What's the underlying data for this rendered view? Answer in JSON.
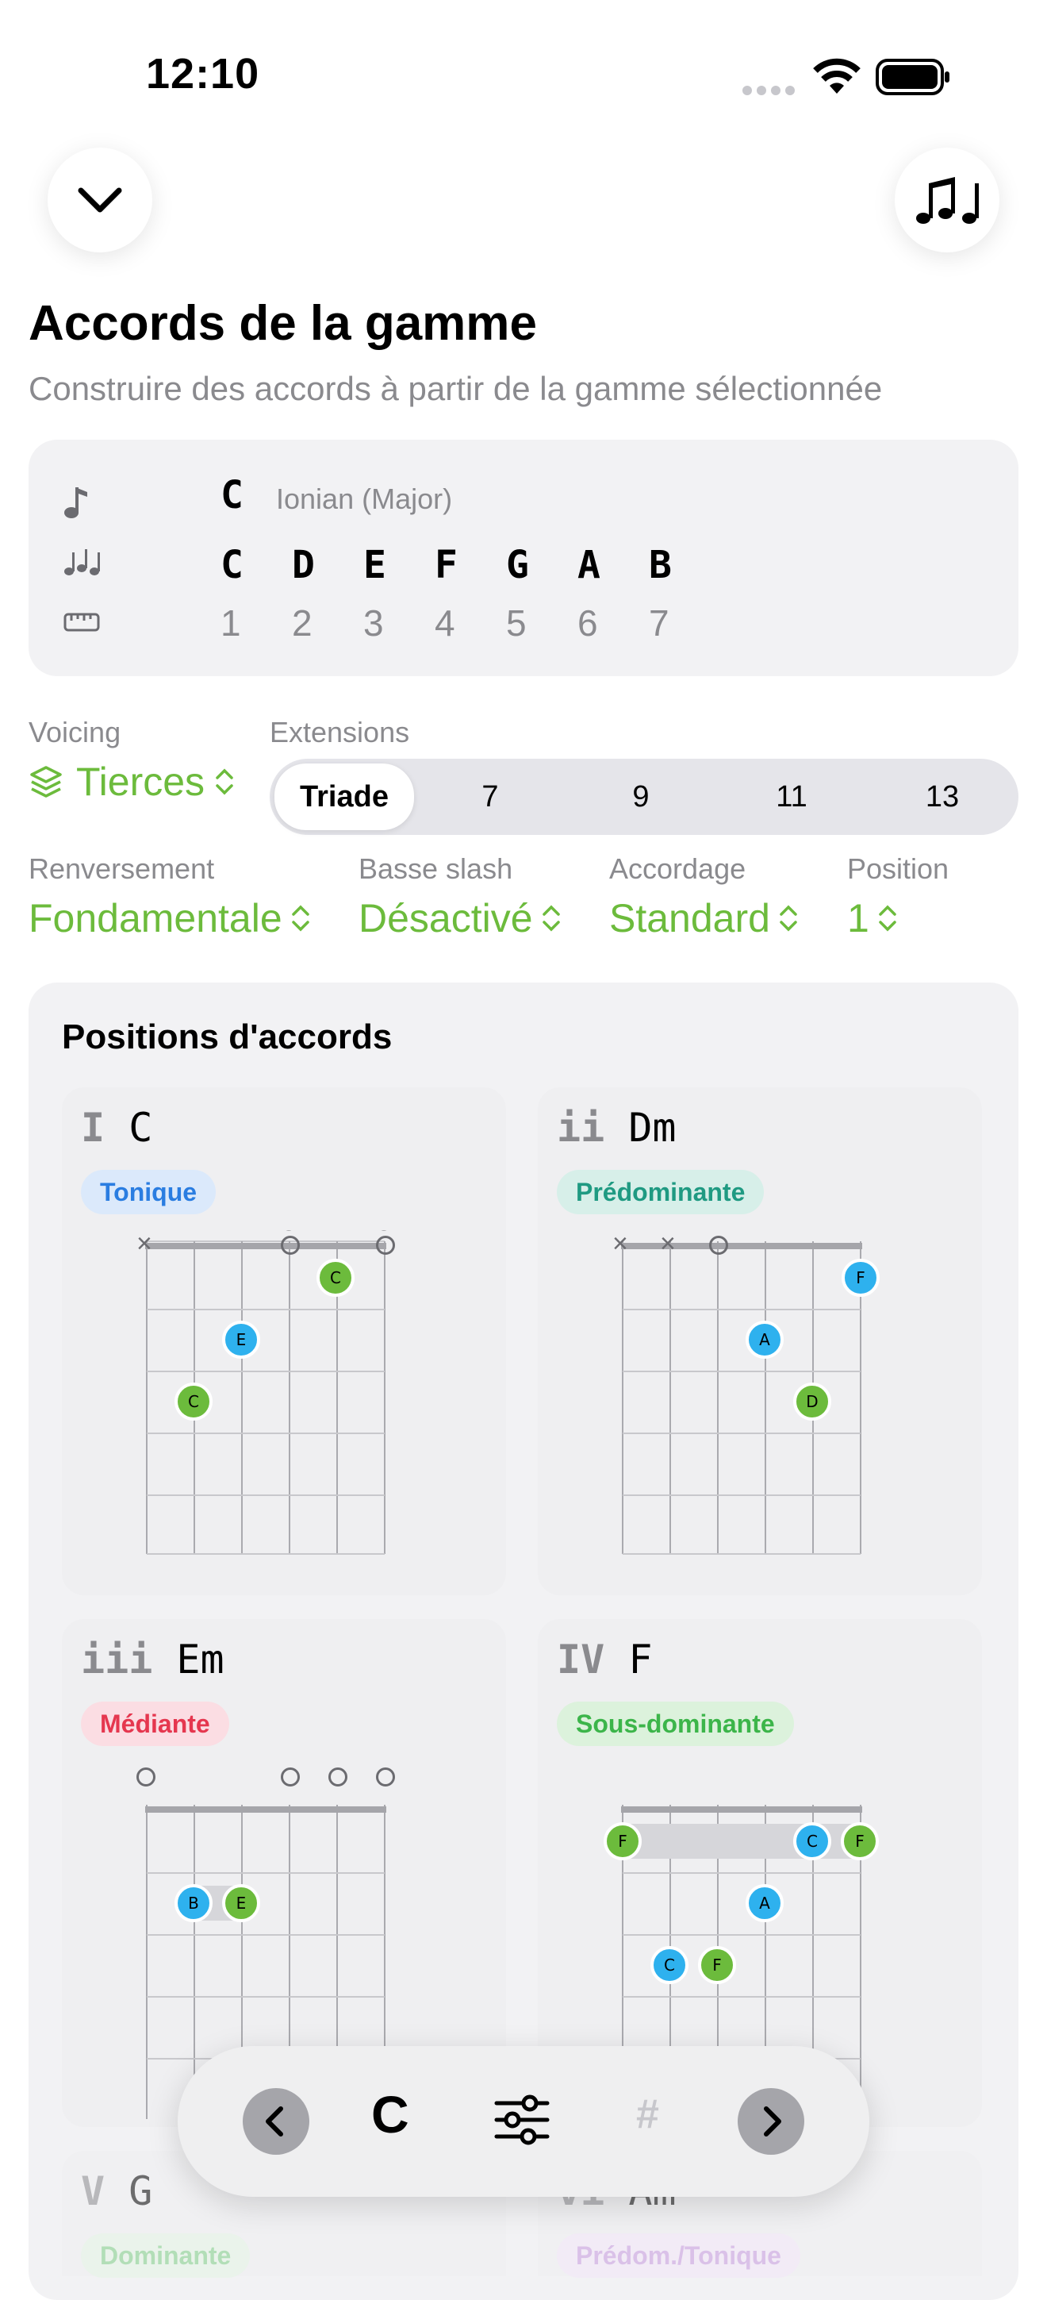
{
  "status": {
    "time": "12:10"
  },
  "header": {
    "title": "Accords de la gamme",
    "subtitle": "Construire des accords à partir de la gamme sélectionnée"
  },
  "scale": {
    "root": "C",
    "mode": "Ionian (Major)",
    "notes": [
      "C",
      "D",
      "E",
      "F",
      "G",
      "A",
      "B"
    ],
    "degrees": [
      "1",
      "2",
      "3",
      "4",
      "5",
      "6",
      "7"
    ]
  },
  "voicing": {
    "label": "Voicing",
    "value": "Tierces"
  },
  "extensions": {
    "label": "Extensions",
    "options": [
      "Triade",
      "7",
      "9",
      "11",
      "13"
    ],
    "selected": "Triade"
  },
  "controls": [
    {
      "label": "Renversement",
      "value": "Fondamentale"
    },
    {
      "label": "Basse slash",
      "value": "Désactivé"
    },
    {
      "label": "Accordage",
      "value": "Standard"
    },
    {
      "label": "Position",
      "value": "1"
    }
  ],
  "positions": {
    "title": "Positions d'accords",
    "chords": [
      {
        "numeral": "I",
        "name": "C",
        "function": "Tonique",
        "pill_bg": "#dbe9fb",
        "pill_fg": "#2a7de1"
      },
      {
        "numeral": "ii",
        "name": "Dm",
        "function": "Prédominante",
        "pill_bg": "#d7efe9",
        "pill_fg": "#1f9a82"
      },
      {
        "numeral": "iii",
        "name": "Em",
        "function": "Médiante",
        "pill_bg": "#fbdde3",
        "pill_fg": "#e5374f"
      },
      {
        "numeral": "IV",
        "name": "F",
        "function": "Sous-dominante",
        "pill_bg": "#dcf2dc",
        "pill_fg": "#3cb54a"
      },
      {
        "numeral": "V",
        "name": "G",
        "function": "Dominante",
        "pill_bg": "#e4f4e4",
        "pill_fg": "#7fcf86"
      },
      {
        "numeral": "vi",
        "name": "Am",
        "function": "Prédom./Tonique",
        "pill_bg": "#f2e6f8",
        "pill_fg": "#c79ae0"
      }
    ]
  },
  "colors": {
    "accent": "#6cbb3c",
    "root_dot": "#6cbb3c",
    "third_dot": "#2eb1ee"
  },
  "bottom_bar": {
    "key": "C",
    "sharp": "#"
  }
}
